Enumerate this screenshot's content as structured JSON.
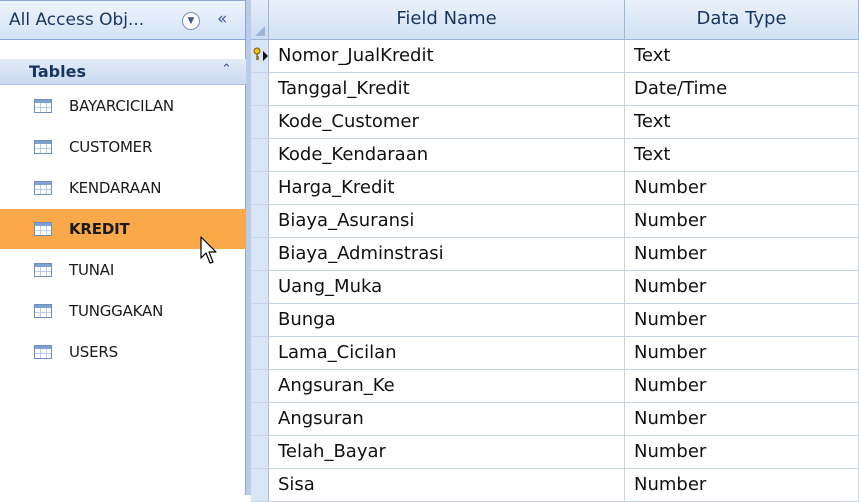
{
  "nav": {
    "title": "All Access Obj...",
    "collapse_glyph": "«",
    "dropdown_glyph": "▼",
    "group": {
      "label": "Tables",
      "chevron": "⌃"
    },
    "items": [
      {
        "label": "BAYARCICILAN",
        "selected": false
      },
      {
        "label": "CUSTOMER",
        "selected": false
      },
      {
        "label": "KENDARAAN",
        "selected": false
      },
      {
        "label": "KREDIT",
        "selected": true
      },
      {
        "label": "TUNAI",
        "selected": false
      },
      {
        "label": "TUNGGAKAN",
        "selected": false
      },
      {
        "label": "USERS",
        "selected": false
      }
    ]
  },
  "grid": {
    "columns": {
      "field_name": "Field Name",
      "data_type": "Data Type"
    },
    "rows": [
      {
        "field": "Nomor_JualKredit",
        "type": "Text",
        "primary_key": true
      },
      {
        "field": "Tanggal_Kredit",
        "type": "Date/Time"
      },
      {
        "field": "Kode_Customer",
        "type": "Text"
      },
      {
        "field": "Kode_Kendaraan",
        "type": "Text"
      },
      {
        "field": "Harga_Kredit",
        "type": "Number"
      },
      {
        "field": "Biaya_Asuransi",
        "type": "Number"
      },
      {
        "field": "Biaya_Adminstrasi",
        "type": "Number"
      },
      {
        "field": "Uang_Muka",
        "type": "Number"
      },
      {
        "field": "Bunga",
        "type": "Number"
      },
      {
        "field": "Lama_Cicilan",
        "type": "Number"
      },
      {
        "field": "Angsuran_Ke",
        "type": "Number"
      },
      {
        "field": "Angsuran",
        "type": "Number"
      },
      {
        "field": "Telah_Bayar",
        "type": "Number"
      },
      {
        "field": "Sisa",
        "type": "Number"
      }
    ]
  },
  "colors": {
    "selected_item": "#f9a94a",
    "header_blue": "#d2e1f4",
    "border_blue": "#8aa9d5"
  }
}
